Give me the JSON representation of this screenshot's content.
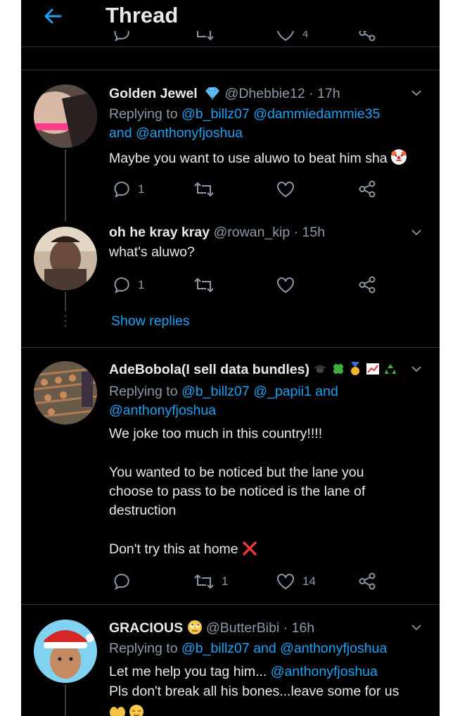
{
  "header": {
    "title": "Thread"
  },
  "top_partial": {
    "like_count": "4"
  },
  "tweets": [
    {
      "name": "Golden Jewel",
      "handle": "@Dhebbie12",
      "time": "· 17h",
      "reply_prefix": "Replying to",
      "reply_mention_1": "@b_billz07",
      "reply_mention_2": "@dammiedammie35",
      "reply_and": "and",
      "reply_mention_3": "@anthonyfjoshua",
      "text": "Maybe you want to use aluwo to beat him sha",
      "reply_count": "1",
      "retweet_count": "",
      "like_count": ""
    },
    {
      "name": "oh he kray kray",
      "handle": "@rowan_kip",
      "time": "· 15h",
      "text": "what's aluwo?",
      "reply_count": "1",
      "retweet_count": "",
      "like_count": "",
      "show_replies": "Show replies"
    },
    {
      "name": "AdeBobola(I sell data bundles)",
      "handle": "",
      "time": "",
      "reply_prefix": "Replying to",
      "reply_mention_1": "@b_billz07",
      "reply_mention_2": "@_papii1",
      "reply_and": "and",
      "reply_mention_3": "@anthonyfjoshua",
      "text_lines": [
        "We joke too much in this country!!!!",
        "You wanted to be noticed but the lane you",
        "choose to pass to be noticed is the lane of",
        "destruction",
        "Don't try this at home"
      ],
      "reply_count": "",
      "retweet_count": "1",
      "like_count": "14"
    },
    {
      "name": "GRACIOUS",
      "handle": "@ButterBibi",
      "time": "· 16h",
      "reply_prefix": "Replying to",
      "reply_mention_1": "@b_billz07",
      "reply_and": "and",
      "reply_mention_3": "@anthonyfjoshua",
      "text_line_1": "Let me help you tag him...",
      "text_mention": "@anthonyfjoshua",
      "text_line_2": "Pls don't break all his bones...leave some for us"
    }
  ],
  "colors": {
    "accent": "#1da1f2",
    "background": "#000000",
    "muted": "#8b98a5",
    "text": "#e7e9ea"
  }
}
